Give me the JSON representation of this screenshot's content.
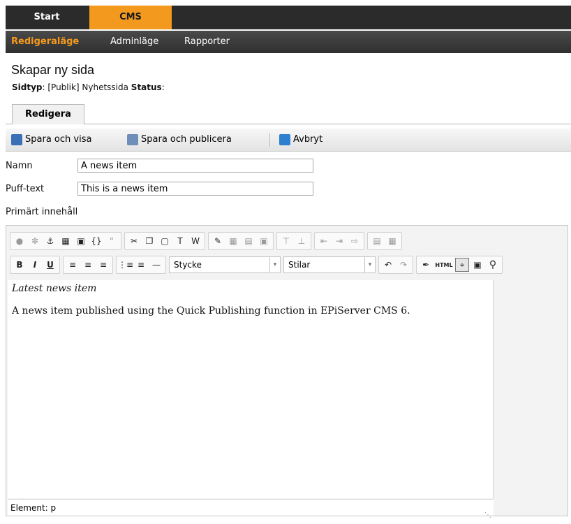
{
  "topnav": {
    "start": "Start",
    "cms": "CMS"
  },
  "subnav": {
    "edit_mode": "Redigeraläge",
    "admin_mode": "Adminläge",
    "reports": "Rapporter"
  },
  "page": {
    "title": "Skapar ny sida",
    "meta_type_label": "Sidtyp",
    "meta_type_value": ": [Publik] Nyhetssida ",
    "meta_status_label": "Status",
    "meta_status_suffix": ":"
  },
  "tabs": [
    {
      "label": "Redigera"
    }
  ],
  "toolbar": {
    "save_view": "Spara och visa",
    "save_publish": "Spara och publicera",
    "cancel": "Avbryt"
  },
  "fields": {
    "name_label": "Namn",
    "name_value": "A news item",
    "puff_label": "Puff-text",
    "puff_value": "This is a news item",
    "main_label": "Primärt innehåll"
  },
  "editor": {
    "format_value": "Stycke",
    "styles_value": "Stilar",
    "html_label": "HTML",
    "paragraphs": [
      "Latest news item",
      "A news item published using the Quick Publishing function in EPiServer CMS 6."
    ],
    "status": "Element: p"
  },
  "colors": {
    "accent": "#f39a1e",
    "nav_bg": "#2b2b2b"
  }
}
